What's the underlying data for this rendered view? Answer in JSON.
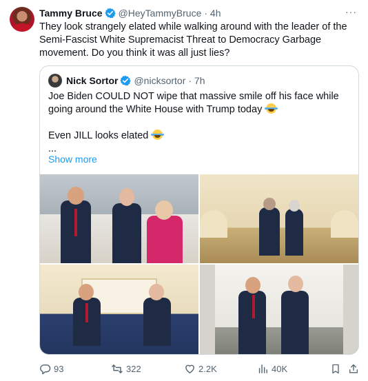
{
  "author": {
    "name": "Tammy Bruce",
    "handle": "@HeyTammyBruce",
    "time": "· 4h"
  },
  "more_label": "···",
  "text": "They look strangely elated while walking around with the leader of the Semi-Fascist White Supremacist Threat to Democracy Garbage movement. Do you think it was all just lies?",
  "quote": {
    "name": "Nick Sortor",
    "handle": "@nicksortor",
    "time": "· 7h",
    "line1": "Joe Biden COULD NOT wipe that massive smile off his face while going around the White House with Trump today",
    "line2": "Even JILL looks elated",
    "line3": "...",
    "show_more": "Show more"
  },
  "stats": {
    "replies": "93",
    "reposts": "322",
    "likes": "2.2K",
    "views": "40K"
  },
  "icons": {
    "verified": "verified-badge-icon",
    "reply": "reply-icon",
    "repost": "repost-icon",
    "like": "heart-icon",
    "views": "views-icon",
    "bookmark": "bookmark-icon",
    "share": "share-icon"
  },
  "colors": {
    "accent": "#1d9bf0",
    "secondary_text": "#536471",
    "border": "#cfd9de"
  }
}
